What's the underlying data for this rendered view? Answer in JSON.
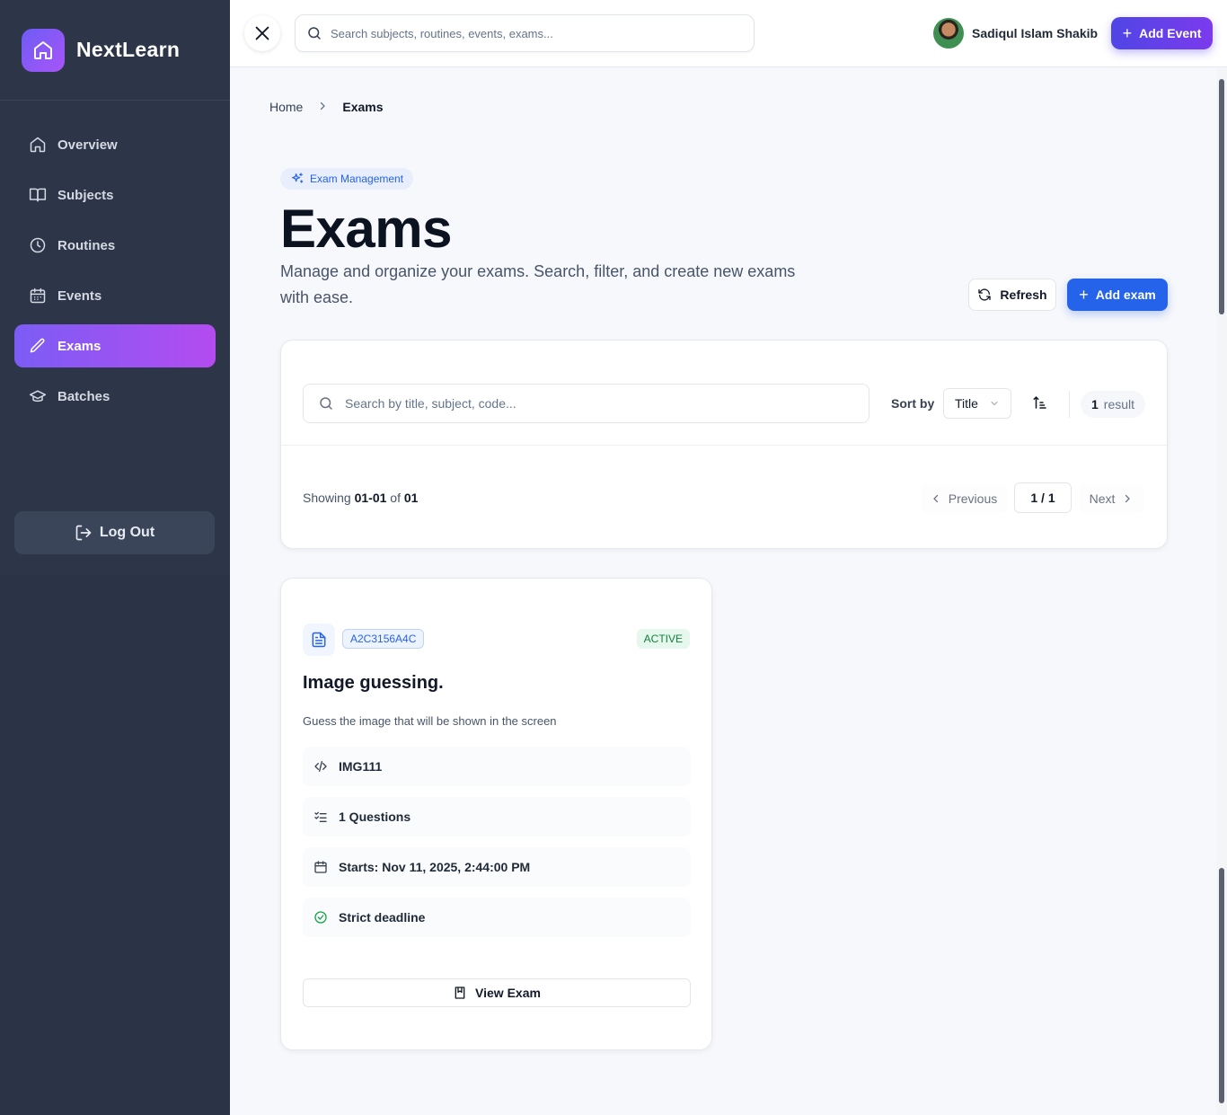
{
  "app": {
    "name": "NextLearn"
  },
  "sidebar": {
    "items": [
      {
        "label": "Overview",
        "icon": "home-icon"
      },
      {
        "label": "Subjects",
        "icon": "book-icon"
      },
      {
        "label": "Routines",
        "icon": "clock-icon"
      },
      {
        "label": "Events",
        "icon": "calendar-icon"
      },
      {
        "label": "Exams",
        "icon": "pen-icon",
        "active": true
      },
      {
        "label": "Batches",
        "icon": "graduation-cap-icon"
      }
    ],
    "logout_label": "Log Out"
  },
  "header": {
    "search_placeholder": "Search subjects, routines, events, exams...",
    "user_name": "Sadiqul Islam Shakib",
    "add_event_label": "Add Event"
  },
  "breadcrumb": {
    "home": "Home",
    "current": "Exams"
  },
  "page": {
    "badge": "Exam Management",
    "title": "Exams",
    "description": "Manage and organize your exams. Search, filter, and create new exams with ease.",
    "refresh_label": "Refresh",
    "add_exam_label": "Add exam"
  },
  "filters": {
    "search_placeholder": "Search by title, subject, code...",
    "sort_label": "Sort by",
    "sort_value": "Title",
    "result_count": "1",
    "result_label": "result"
  },
  "pagination": {
    "showing_prefix": "Showing",
    "range": "01-01",
    "of_label": "of",
    "total": "01",
    "previous_label": "Previous",
    "page_indicator": "1 / 1",
    "next_label": "Next"
  },
  "exam_card": {
    "code": "A2C3156A4C",
    "status": "ACTIVE",
    "title": "Image guessing.",
    "description": "Guess the image that will be shown in the screen",
    "exam_code": "IMG111",
    "questions": "1 Questions",
    "starts": "Starts: Nov 11, 2025, 2:44:00 PM",
    "deadline": "Strict deadline",
    "view_label": "View Exam"
  },
  "colors": {
    "sidebar_bg": "#2b3447",
    "active_gradient_start": "#7c5cf5",
    "active_gradient_end": "#b44cf0",
    "primary": "#2563eb",
    "status_green": "#15803d"
  }
}
